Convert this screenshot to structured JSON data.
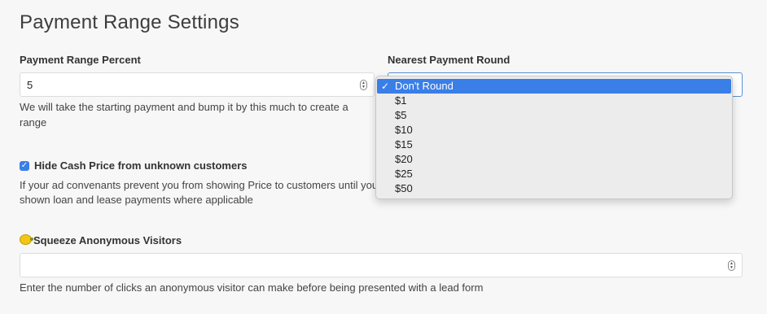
{
  "page": {
    "title": "Payment Range Settings"
  },
  "range_percent": {
    "label": "Payment Range Percent",
    "value": "5",
    "help": "We will take the starting payment and bump it by this much to create a range"
  },
  "payment_round": {
    "label": "Nearest Payment Round",
    "selected": "Don't Round",
    "options": [
      "Don't Round",
      "$1",
      "$5",
      "$10",
      "$15",
      "$20",
      "$25",
      "$50"
    ],
    "check_glyph": "✓"
  },
  "hide_cash": {
    "label": "Hide Cash Price from unknown customers",
    "checked": true,
    "check_glyph": "✓",
    "help_line1": "If your ad convenants prevent you from showing Price to customers until you a",
    "help_line2": "shown loan and lease payments where applicable"
  },
  "squeeze": {
    "icon": "lemon-icon",
    "label": "Squeeze Anonymous Visitors",
    "value": "",
    "help": "Enter the number of clicks an anonymous visitor can make before being presented with a lead form"
  },
  "colors": {
    "accent": "#3a7ee8",
    "background": "#f7f7f7"
  }
}
